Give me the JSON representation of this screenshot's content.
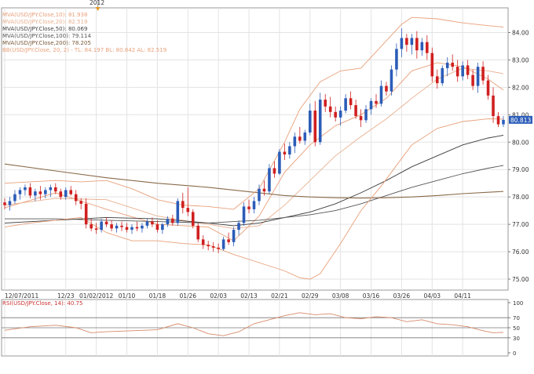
{
  "chart_data": {
    "type": "candlestick",
    "instrument": "USD/JPY",
    "year_marker": "2012",
    "legend": [
      {
        "text": "MVA(USD/JPY.Close,10): 81.938",
        "color": "#e8a07a"
      },
      {
        "text": "MVA(USD/JPY.Close,20): 82.519",
        "color": "#e8b090"
      },
      {
        "text": "MVA(USD/JPY.Close,50): 80.069",
        "color": "#444444"
      },
      {
        "text": "MVA(USD/JPY.Close,100): 79.114",
        "color": "#555555"
      },
      {
        "text": "MVA(USD/JPY.Close,200): 78.205",
        "color": "#7a5a3a"
      },
      {
        "text": "BB(USD/JPY.Close, 20, 2) - TL: 84.197  BL: 80.842  AL: 82.519",
        "color": "#e8a07a"
      }
    ],
    "price_axis": {
      "min": 74.6,
      "max": 84.9,
      "ticks": [
        "84.00",
        "83.00",
        "82.00",
        "81.00",
        "80.00",
        "79.00",
        "78.00",
        "77.00",
        "76.00",
        "75.00"
      ],
      "tick_values": [
        84,
        83,
        82,
        81,
        80,
        79,
        78,
        77,
        76,
        75
      ],
      "last_price": "80.813",
      "last_price_value": 80.813
    },
    "date_labels": [
      "12/07/2011",
      "12/23",
      "01/02/2012",
      "01/10",
      "01/18",
      "01/26",
      "02/03",
      "02/13",
      "02/21",
      "02/29",
      "03/08",
      "03/16",
      "03/26",
      "04/03",
      "04/11"
    ],
    "date_label_index": [
      0,
      12,
      18,
      24,
      30,
      36,
      42,
      48,
      54,
      60,
      66,
      72,
      78,
      84,
      90
    ],
    "ohlc": [
      [
        77.8,
        77.95,
        77.55,
        77.7
      ],
      [
        77.7,
        78.0,
        77.5,
        77.85
      ],
      [
        77.85,
        78.25,
        77.75,
        78.1
      ],
      [
        78.1,
        78.35,
        77.9,
        78.25
      ],
      [
        78.25,
        78.45,
        78.05,
        78.35
      ],
      [
        78.35,
        78.5,
        77.95,
        78.05
      ],
      [
        78.05,
        78.3,
        77.85,
        78.2
      ],
      [
        78.2,
        78.4,
        77.9,
        78.1
      ],
      [
        78.1,
        78.35,
        77.95,
        78.25
      ],
      [
        78.25,
        78.45,
        78.0,
        78.35
      ],
      [
        78.35,
        78.5,
        78.1,
        78.2
      ],
      [
        78.2,
        78.3,
        77.9,
        78.0
      ],
      [
        78.0,
        78.35,
        77.9,
        78.25
      ],
      [
        78.25,
        78.4,
        78.05,
        78.1
      ],
      [
        78.1,
        78.25,
        77.7,
        77.85
      ],
      [
        77.85,
        77.95,
        77.55,
        77.75
      ],
      [
        77.75,
        77.95,
        76.85,
        77.0
      ],
      [
        77.0,
        77.2,
        76.75,
        76.85
      ],
      [
        76.85,
        77.05,
        76.65,
        76.8
      ],
      [
        76.8,
        77.2,
        76.7,
        77.1
      ],
      [
        77.1,
        77.25,
        76.9,
        77.0
      ],
      [
        77.0,
        77.15,
        76.75,
        76.85
      ],
      [
        76.85,
        77.05,
        76.7,
        76.95
      ],
      [
        76.95,
        77.1,
        76.75,
        76.9
      ],
      [
        76.9,
        77.05,
        76.7,
        76.8
      ],
      [
        76.8,
        77.0,
        76.65,
        76.9
      ],
      [
        76.9,
        77.1,
        76.75,
        76.85
      ],
      [
        76.85,
        77.05,
        76.7,
        76.95
      ],
      [
        76.95,
        77.2,
        76.85,
        77.1
      ],
      [
        77.1,
        77.25,
        76.9,
        77.0
      ],
      [
        77.0,
        77.15,
        76.7,
        76.8
      ],
      [
        76.8,
        77.05,
        76.65,
        77.0
      ],
      [
        77.0,
        77.3,
        76.9,
        77.2
      ],
      [
        77.2,
        77.35,
        76.95,
        77.05
      ],
      [
        77.05,
        77.95,
        76.95,
        77.85
      ],
      [
        77.85,
        78.15,
        77.4,
        77.6
      ],
      [
        77.6,
        78.35,
        77.3,
        77.45
      ],
      [
        77.45,
        77.55,
        76.85,
        76.95
      ],
      [
        76.95,
        77.05,
        76.35,
        76.45
      ],
      [
        76.45,
        76.6,
        76.1,
        76.25
      ],
      [
        76.25,
        76.4,
        76.05,
        76.2
      ],
      [
        76.2,
        76.35,
        76.0,
        76.15
      ],
      [
        76.15,
        76.3,
        75.95,
        76.1
      ],
      [
        76.1,
        76.55,
        76.05,
        76.45
      ],
      [
        76.45,
        76.7,
        76.25,
        76.35
      ],
      [
        76.35,
        76.9,
        76.2,
        76.8
      ],
      [
        76.8,
        77.15,
        76.6,
        77.05
      ],
      [
        77.05,
        77.8,
        76.95,
        77.65
      ],
      [
        77.65,
        77.9,
        77.4,
        77.55
      ],
      [
        77.55,
        78.0,
        77.4,
        77.85
      ],
      [
        77.85,
        78.45,
        77.7,
        78.3
      ],
      [
        78.3,
        78.6,
        78.05,
        78.2
      ],
      [
        78.2,
        79.2,
        78.1,
        79.05
      ],
      [
        79.05,
        79.3,
        78.7,
        78.85
      ],
      [
        78.85,
        79.75,
        78.8,
        79.65
      ],
      [
        79.65,
        79.95,
        79.35,
        79.55
      ],
      [
        79.55,
        80.0,
        79.4,
        79.85
      ],
      [
        79.85,
        80.35,
        79.6,
        80.2
      ],
      [
        80.2,
        80.55,
        79.95,
        80.05
      ],
      [
        80.05,
        80.45,
        79.9,
        80.35
      ],
      [
        80.35,
        81.4,
        80.25,
        81.15
      ],
      [
        81.15,
        81.5,
        79.85,
        80.0
      ],
      [
        80.0,
        81.8,
        79.9,
        81.55
      ],
      [
        81.55,
        81.75,
        81.1,
        81.3
      ],
      [
        81.3,
        81.65,
        80.9,
        81.1
      ],
      [
        81.1,
        81.3,
        80.75,
        80.9
      ],
      [
        80.9,
        81.3,
        80.6,
        81.15
      ],
      [
        81.15,
        81.75,
        81.05,
        81.6
      ],
      [
        81.6,
        81.85,
        81.2,
        81.35
      ],
      [
        81.35,
        81.55,
        80.85,
        80.95
      ],
      [
        80.95,
        81.2,
        80.55,
        80.8
      ],
      [
        80.8,
        81.35,
        80.7,
        81.2
      ],
      [
        81.2,
        81.6,
        81.0,
        81.5
      ],
      [
        81.5,
        81.75,
        81.25,
        81.4
      ],
      [
        81.4,
        82.25,
        81.3,
        82.05
      ],
      [
        82.05,
        82.2,
        81.7,
        81.85
      ],
      [
        81.85,
        82.8,
        81.7,
        82.65
      ],
      [
        82.65,
        83.6,
        82.4,
        83.4
      ],
      [
        83.4,
        84.15,
        83.1,
        83.8
      ],
      [
        83.8,
        83.95,
        83.3,
        83.55
      ],
      [
        83.55,
        83.95,
        83.2,
        83.8
      ],
      [
        83.8,
        84.05,
        83.05,
        83.35
      ],
      [
        83.35,
        83.8,
        83.15,
        83.65
      ],
      [
        83.65,
        83.9,
        83.0,
        83.25
      ],
      [
        83.25,
        83.45,
        82.2,
        82.4
      ],
      [
        82.4,
        82.65,
        81.95,
        82.15
      ],
      [
        82.15,
        82.8,
        82.05,
        82.7
      ],
      [
        82.7,
        83.1,
        82.4,
        82.9
      ],
      [
        82.9,
        83.2,
        82.6,
        82.75
      ],
      [
        82.75,
        83.0,
        82.2,
        82.4
      ],
      [
        82.4,
        82.95,
        82.25,
        82.8
      ],
      [
        82.8,
        83.0,
        82.3,
        82.45
      ],
      [
        82.45,
        82.65,
        81.9,
        82.05
      ],
      [
        82.05,
        82.9,
        81.8,
        82.75
      ],
      [
        82.75,
        82.95,
        82.1,
        82.25
      ],
      [
        82.25,
        82.45,
        81.55,
        81.7
      ],
      [
        81.7,
        82.0,
        80.7,
        80.95
      ],
      [
        80.95,
        81.1,
        80.55,
        80.65
      ],
      [
        80.65,
        80.95,
        80.55,
        80.81
      ]
    ],
    "lines": {
      "mva_10": [
        [
          0,
          77.6
        ],
        [
          10,
          78.15
        ],
        [
          20,
          77.55
        ],
        [
          30,
          77.0
        ],
        [
          40,
          76.9
        ],
        [
          45,
          76.4
        ],
        [
          50,
          77.3
        ],
        [
          55,
          78.9
        ],
        [
          60,
          79.9
        ],
        [
          65,
          80.6
        ],
        [
          70,
          81.0
        ],
        [
          75,
          81.6
        ],
        [
          80,
          82.6
        ],
        [
          85,
          82.9
        ],
        [
          90,
          82.75
        ],
        [
          95,
          82.3
        ],
        [
          98,
          81.9
        ]
      ],
      "mva_20": [
        [
          0,
          77.7
        ],
        [
          10,
          77.95
        ],
        [
          20,
          77.9
        ],
        [
          30,
          77.3
        ],
        [
          40,
          77.0
        ],
        [
          45,
          76.85
        ],
        [
          50,
          76.95
        ],
        [
          55,
          77.7
        ],
        [
          60,
          78.6
        ],
        [
          65,
          79.5
        ],
        [
          70,
          80.2
        ],
        [
          75,
          80.85
        ],
        [
          80,
          81.6
        ],
        [
          85,
          82.3
        ],
        [
          90,
          82.7
        ],
        [
          95,
          82.6
        ],
        [
          98,
          82.5
        ]
      ],
      "mva_50": [
        [
          0,
          77.05
        ],
        [
          10,
          77.15
        ],
        [
          20,
          77.25
        ],
        [
          30,
          77.2
        ],
        [
          40,
          77.05
        ],
        [
          45,
          76.95
        ],
        [
          50,
          77.05
        ],
        [
          55,
          77.25
        ],
        [
          60,
          77.45
        ],
        [
          65,
          77.75
        ],
        [
          70,
          78.15
        ],
        [
          75,
          78.6
        ],
        [
          80,
          79.1
        ],
        [
          85,
          79.5
        ],
        [
          90,
          79.9
        ],
        [
          95,
          80.15
        ],
        [
          98,
          80.25
        ]
      ],
      "mva_100": [
        [
          0,
          77.2
        ],
        [
          10,
          77.2
        ],
        [
          20,
          77.15
        ],
        [
          30,
          77.1
        ],
        [
          40,
          77.05
        ],
        [
          45,
          77.1
        ],
        [
          50,
          77.15
        ],
        [
          55,
          77.25
        ],
        [
          60,
          77.35
        ],
        [
          65,
          77.5
        ],
        [
          70,
          77.75
        ],
        [
          75,
          78.05
        ],
        [
          80,
          78.35
        ],
        [
          85,
          78.6
        ],
        [
          90,
          78.85
        ],
        [
          95,
          79.05
        ],
        [
          98,
          79.15
        ]
      ],
      "mva_200": [
        [
          0,
          79.2
        ],
        [
          10,
          78.95
        ],
        [
          20,
          78.7
        ],
        [
          30,
          78.5
        ],
        [
          40,
          78.35
        ],
        [
          45,
          78.25
        ],
        [
          50,
          78.15
        ],
        [
          55,
          78.05
        ],
        [
          60,
          78.0
        ],
        [
          65,
          77.97
        ],
        [
          70,
          77.96
        ],
        [
          75,
          77.97
        ],
        [
          80,
          78.0
        ],
        [
          85,
          78.05
        ],
        [
          90,
          78.12
        ],
        [
          95,
          78.17
        ],
        [
          98,
          78.2
        ]
      ],
      "bb_upper": [
        [
          0,
          78.5
        ],
        [
          10,
          78.6
        ],
        [
          15,
          78.55
        ],
        [
          20,
          78.6
        ],
        [
          25,
          78.3
        ],
        [
          30,
          77.9
        ],
        [
          35,
          77.7
        ],
        [
          40,
          77.65
        ],
        [
          45,
          77.55
        ],
        [
          50,
          78.3
        ],
        [
          55,
          80.0
        ],
        [
          58,
          81.2
        ],
        [
          62,
          82.2
        ],
        [
          66,
          82.6
        ],
        [
          70,
          82.7
        ],
        [
          74,
          83.5
        ],
        [
          78,
          84.3
        ],
        [
          80,
          84.55
        ],
        [
          85,
          84.5
        ],
        [
          90,
          84.35
        ],
        [
          95,
          84.25
        ],
        [
          98,
          84.2
        ]
      ],
      "bb_lower": [
        [
          0,
          76.9
        ],
        [
          5,
          77.05
        ],
        [
          10,
          77.15
        ],
        [
          15,
          77.25
        ],
        [
          20,
          76.7
        ],
        [
          25,
          76.4
        ],
        [
          30,
          76.4
        ],
        [
          35,
          76.3
        ],
        [
          40,
          76.25
        ],
        [
          45,
          75.9
        ],
        [
          50,
          75.6
        ],
        [
          55,
          75.3
        ],
        [
          58,
          75.05
        ],
        [
          60,
          75.0
        ],
        [
          62,
          75.2
        ],
        [
          66,
          76.3
        ],
        [
          70,
          77.5
        ],
        [
          74,
          78.4
        ],
        [
          78,
          79.4
        ],
        [
          80,
          79.9
        ],
        [
          85,
          80.5
        ],
        [
          90,
          80.75
        ],
        [
          95,
          80.85
        ],
        [
          98,
          80.84
        ]
      ]
    },
    "rsi": {
      "label": "RSI(USD/JPY.Close, 14): 40.75",
      "min": 0,
      "max": 100,
      "ticks": [
        "100",
        "70",
        "50",
        "30",
        "0"
      ],
      "tick_values": [
        100,
        70,
        50,
        30,
        0
      ],
      "values": [
        [
          0,
          45
        ],
        [
          5,
          52
        ],
        [
          10,
          55
        ],
        [
          14,
          50
        ],
        [
          17,
          40
        ],
        [
          20,
          42
        ],
        [
          25,
          44
        ],
        [
          30,
          46
        ],
        [
          34,
          58
        ],
        [
          37,
          50
        ],
        [
          40,
          38
        ],
        [
          43,
          34
        ],
        [
          46,
          42
        ],
        [
          49,
          58
        ],
        [
          52,
          66
        ],
        [
          55,
          74
        ],
        [
          58,
          80
        ],
        [
          61,
          76
        ],
        [
          64,
          78
        ],
        [
          67,
          70
        ],
        [
          70,
          68
        ],
        [
          73,
          72
        ],
        [
          76,
          70
        ],
        [
          79,
          62
        ],
        [
          82,
          66
        ],
        [
          85,
          58
        ],
        [
          88,
          56
        ],
        [
          91,
          52
        ],
        [
          94,
          44
        ],
        [
          96,
          40
        ],
        [
          98,
          40.75
        ]
      ]
    },
    "colors": {
      "up": "#2b5cb8",
      "down": "#d01f1f",
      "background": "#ffffff",
      "grid": "#e3e3e3",
      "last_price_bg": "#2b5cb8"
    }
  }
}
